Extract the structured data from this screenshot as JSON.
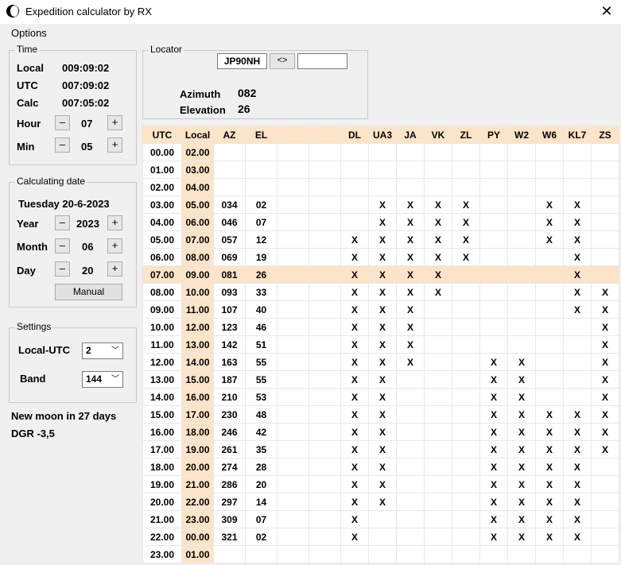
{
  "window": {
    "title": "Expedition calculator by RX",
    "close_symbol": "✕"
  },
  "menu": {
    "options": "Options"
  },
  "time": {
    "legend": "Time",
    "local_label": "Local",
    "local_value": "009:09:02",
    "utc_label": "UTC",
    "utc_value": "007:09:02",
    "calc_label": "Calc",
    "calc_value": "007:05:02",
    "hour_label": "Hour",
    "hour_value": "07",
    "min_label": "Min",
    "min_value": "05",
    "minus": "–",
    "plus": "+"
  },
  "calc_date": {
    "legend": "Calculating date",
    "date_text": "Tuesday 20-6-2023",
    "year_label": "Year",
    "year_value": "2023",
    "month_label": "Month",
    "month_value": "06",
    "day_label": "Day",
    "day_value": "20",
    "manual_label": "Manual"
  },
  "settings": {
    "legend": "Settings",
    "local_utc_label": "Local-UTC",
    "local_utc_value": "2",
    "band_label": "Band",
    "band_value": "144",
    "chevron": "﹀"
  },
  "status": {
    "moon_text": "New moon in 27 days",
    "dgr_text": "DGR -3,5"
  },
  "locator": {
    "legend": "Locator",
    "value": "JP90NH",
    "swap_label": "<>",
    "other_value": "",
    "azimuth_label": "Azimuth",
    "azimuth_value": "082",
    "elevation_label": "Elevation",
    "elevation_value": "26"
  },
  "table": {
    "headers": [
      "UTC",
      "Local",
      "AZ",
      "EL",
      "",
      "",
      "DL",
      "UA3",
      "JA",
      "VK",
      "ZL",
      "PY",
      "W2",
      "W6",
      "KL7",
      "ZS"
    ],
    "selected_row": 7,
    "rows": [
      [
        "00.00",
        "02.00",
        "",
        "",
        "",
        "",
        "",
        "",
        "",
        "",
        "",
        "",
        "",
        "",
        "",
        ""
      ],
      [
        "01.00",
        "03.00",
        "",
        "",
        "",
        "",
        "",
        "",
        "",
        "",
        "",
        "",
        "",
        "",
        "",
        ""
      ],
      [
        "02.00",
        "04.00",
        "",
        "",
        "",
        "",
        "",
        "",
        "",
        "",
        "",
        "",
        "",
        "",
        "",
        ""
      ],
      [
        "03.00",
        "05.00",
        "034",
        "02",
        "",
        "",
        "",
        "X",
        "X",
        "X",
        "X",
        "",
        "",
        "X",
        "X",
        ""
      ],
      [
        "04.00",
        "06.00",
        "046",
        "07",
        "",
        "",
        "",
        "X",
        "X",
        "X",
        "X",
        "",
        "",
        "X",
        "X",
        ""
      ],
      [
        "05.00",
        "07.00",
        "057",
        "12",
        "",
        "",
        "X",
        "X",
        "X",
        "X",
        "X",
        "",
        "",
        "X",
        "X",
        ""
      ],
      [
        "06.00",
        "08.00",
        "069",
        "19",
        "",
        "",
        "X",
        "X",
        "X",
        "X",
        "X",
        "",
        "",
        "",
        "X",
        ""
      ],
      [
        "07.00",
        "09.00",
        "081",
        "26",
        "",
        "",
        "X",
        "X",
        "X",
        "X",
        "",
        "",
        "",
        "",
        "X",
        ""
      ],
      [
        "08.00",
        "10.00",
        "093",
        "33",
        "",
        "",
        "X",
        "X",
        "X",
        "X",
        "",
        "",
        "",
        "",
        "X",
        "X"
      ],
      [
        "09.00",
        "11.00",
        "107",
        "40",
        "",
        "",
        "X",
        "X",
        "X",
        "",
        "",
        "",
        "",
        "",
        "X",
        "X"
      ],
      [
        "10.00",
        "12.00",
        "123",
        "46",
        "",
        "",
        "X",
        "X",
        "X",
        "",
        "",
        "",
        "",
        "",
        "",
        "X"
      ],
      [
        "11.00",
        "13.00",
        "142",
        "51",
        "",
        "",
        "X",
        "X",
        "X",
        "",
        "",
        "",
        "",
        "",
        "",
        "X"
      ],
      [
        "12.00",
        "14.00",
        "163",
        "55",
        "",
        "",
        "X",
        "X",
        "X",
        "",
        "",
        "X",
        "X",
        "",
        "",
        "X"
      ],
      [
        "13.00",
        "15.00",
        "187",
        "55",
        "",
        "",
        "X",
        "X",
        "",
        "",
        "",
        "X",
        "X",
        "",
        "",
        "X"
      ],
      [
        "14.00",
        "16.00",
        "210",
        "53",
        "",
        "",
        "X",
        "X",
        "",
        "",
        "",
        "X",
        "X",
        "",
        "",
        "X"
      ],
      [
        "15.00",
        "17.00",
        "230",
        "48",
        "",
        "",
        "X",
        "X",
        "",
        "",
        "",
        "X",
        "X",
        "X",
        "X",
        "X"
      ],
      [
        "16.00",
        "18.00",
        "246",
        "42",
        "",
        "",
        "X",
        "X",
        "",
        "",
        "",
        "X",
        "X",
        "X",
        "X",
        "X"
      ],
      [
        "17.00",
        "19.00",
        "261",
        "35",
        "",
        "",
        "X",
        "X",
        "",
        "",
        "",
        "X",
        "X",
        "X",
        "X",
        "X"
      ],
      [
        "18.00",
        "20.00",
        "274",
        "28",
        "",
        "",
        "X",
        "X",
        "",
        "",
        "",
        "X",
        "X",
        "X",
        "X",
        ""
      ],
      [
        "19.00",
        "21.00",
        "286",
        "20",
        "",
        "",
        "X",
        "X",
        "",
        "",
        "",
        "X",
        "X",
        "X",
        "X",
        ""
      ],
      [
        "20.00",
        "22.00",
        "297",
        "14",
        "",
        "",
        "X",
        "X",
        "",
        "",
        "",
        "X",
        "X",
        "X",
        "X",
        ""
      ],
      [
        "21.00",
        "23.00",
        "309",
        "07",
        "",
        "",
        "X",
        "",
        "",
        "",
        "",
        "X",
        "X",
        "X",
        "X",
        ""
      ],
      [
        "22.00",
        "00.00",
        "321",
        "02",
        "",
        "",
        "X",
        "",
        "",
        "",
        "",
        "X",
        "X",
        "X",
        "X",
        ""
      ],
      [
        "23.00",
        "01.00",
        "",
        "",
        "",
        "",
        "",
        "",
        "",
        "",
        "",
        "",
        "",
        "",
        "",
        ""
      ]
    ]
  },
  "colors": {
    "header_bg": "#fde3c8",
    "selected_bg": "#fde3c8",
    "window_bg": "#f0f0f0"
  }
}
